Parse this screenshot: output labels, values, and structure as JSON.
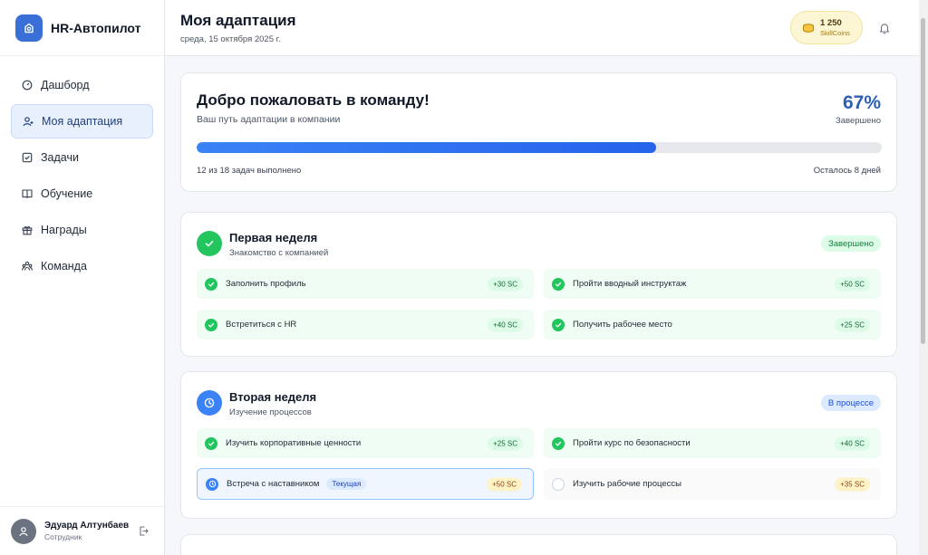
{
  "app": {
    "name": "HR-Автопилот"
  },
  "sidebar": {
    "items": [
      {
        "label": "Дашборд",
        "icon": "dashboard-icon"
      },
      {
        "label": "Моя адаптация",
        "icon": "user-plus-icon",
        "active": true
      },
      {
        "label": "Задачи",
        "icon": "checkbox-icon"
      },
      {
        "label": "Обучение",
        "icon": "book-icon"
      },
      {
        "label": "Награды",
        "icon": "gift-icon"
      },
      {
        "label": "Команда",
        "icon": "team-icon"
      }
    ]
  },
  "user": {
    "name": "Эдуард Алтунбаев",
    "role": "Сотрудник"
  },
  "header": {
    "title": "Моя адаптация",
    "date": "среда, 15 октября 2025 г.",
    "coins_value": "1 250",
    "coins_label": "SkillCoins"
  },
  "welcome": {
    "title": "Добро пожаловать в команду!",
    "subtitle": "Ваш путь адаптации в компании",
    "percent": "67%",
    "percent_label": "Завершено",
    "progress": 0.67,
    "tasks_count": "12 из 18 задач выполнено",
    "days_left": "Осталось 8 дней"
  },
  "weeks": [
    {
      "title": "Первая неделя",
      "subtitle": "Знакомство с компанией",
      "status": "Завершено",
      "tasks": [
        {
          "label": "Заполнить профиль",
          "points": "+30 SC"
        },
        {
          "label": "Пройти вводный инструктаж",
          "points": "+50 SC"
        },
        {
          "label": "Встретиться с HR",
          "points": "+40 SC"
        },
        {
          "label": "Получить рабочее место",
          "points": "+25 SC"
        }
      ]
    },
    {
      "title": "Вторая неделя",
      "subtitle": "Изучение процессов",
      "status": "В процессе",
      "tasks": [
        {
          "label": "Изучить корпоративные ценности",
          "points": "+25 SC"
        },
        {
          "label": "Пройти курс по безопасности",
          "points": "+40 SC"
        },
        {
          "label": "Встреча с наставником",
          "points": "+50 SC",
          "tag": "Текущая"
        },
        {
          "label": "Изучить рабочие процессы",
          "points": "+35 SC"
        }
      ]
    }
  ],
  "colors": {
    "accent": "#3b6fd8",
    "success": "#22c55e",
    "progress": "#2563eb",
    "coins_bg": "#fdf6d4"
  }
}
